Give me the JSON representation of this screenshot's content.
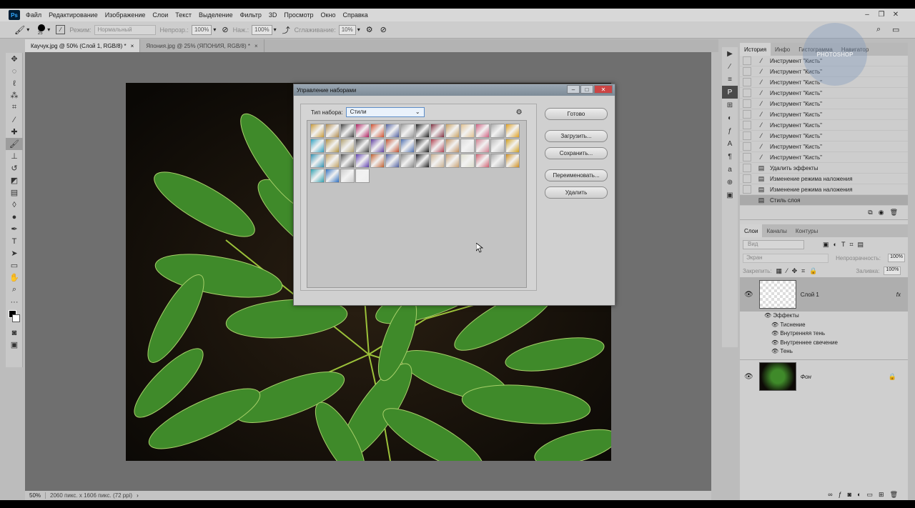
{
  "menu": {
    "logo": "Ps",
    "items": [
      "Файл",
      "Редактирование",
      "Изображение",
      "Слои",
      "Текст",
      "Выделение",
      "Фильтр",
      "3D",
      "Просмотр",
      "Окно",
      "Справка"
    ]
  },
  "options": {
    "brush_size": "25",
    "mode_label": "Режим:",
    "mode_value": "Нормальный",
    "opacity_label": "Непрозр.:",
    "opacity_value": "100%",
    "flow_label": "Наж.:",
    "flow_value": "100%",
    "smooth_label": "Сглаживание:",
    "smooth_value": "10%"
  },
  "tabs": [
    {
      "label": "Каучук.jpg @ 50% (Слой 1, RGB/8) *",
      "close": "×"
    },
    {
      "label": "Япония.jpg @ 25% (ЯПОНИЯ, RGB/8) *",
      "close": "×"
    }
  ],
  "status": {
    "zoom": "50%",
    "info": "2060 пикс. х 1606 пикс. (72 ppi)"
  },
  "dialog": {
    "title": "Управление наборами",
    "type_label": "Тип набора:",
    "type_value": "Стили",
    "buttons": [
      "Готово",
      "Загрузить...",
      "Сохранить...",
      "Переименовать...",
      "Удалить"
    ],
    "swatch_colors": [
      "#c89a3a",
      "#b08a4a",
      "#444",
      "#b02060",
      "#d05030",
      "#5060a0",
      "#999",
      "#222",
      "#803040",
      "#c8a060",
      "#e0c090",
      "#d06080",
      "#aaa",
      "#e0a020",
      "#30a0c0",
      "#b09040",
      "#b0a070",
      "#444",
      "#6040a0",
      "#c05030",
      "#5070b0",
      "#222",
      "#b04050",
      "#c09060",
      "#ddd",
      "#d08090",
      "#bbb",
      "#d0a020",
      "#3090b0",
      "#c0a060",
      "#555",
      "#6040b0",
      "#c06030",
      "#5060a0",
      "#888",
      "#222",
      "#c9b090",
      "#c8a070",
      "#ddc",
      "#d06070",
      "#aaa",
      "#d09020",
      "#30a0b0",
      "#3070c0",
      "#ccc",
      "#eee"
    ]
  },
  "history": {
    "tabs": [
      "История",
      "Инфо",
      "Гистограмма",
      "Навигатор"
    ],
    "items": [
      "Инструмент \"Кисть\"",
      "Инструмент \"Кисть\"",
      "Инструмент \"Кисть\"",
      "Инструмент \"Кисть\"",
      "Инструмент \"Кисть\"",
      "Инструмент \"Кисть\"",
      "Инструмент \"Кисть\"",
      "Инструмент \"Кисть\"",
      "Инструмент \"Кисть\"",
      "Инструмент \"Кисть\"",
      "Удалить эффекты",
      "Изменение режима наложения",
      "Изменение режима наложения",
      "Стиль слоя"
    ]
  },
  "layers": {
    "tabs": [
      "Слои",
      "Каналы",
      "Контуры"
    ],
    "filter_placeholder": "Вид",
    "blend_mode": "Экран",
    "opacity_label": "Непрозрачность:",
    "opacity_value": "100%",
    "lock_label": "Закрепить:",
    "fill_label": "Заливка:",
    "fill_value": "100%",
    "layer1": {
      "name": "Слой 1",
      "fx": "fx"
    },
    "effects_label": "Эффекты",
    "effects": [
      "Тиснение",
      "Внутренняя тень",
      "Внутреннее свечение",
      "Тень"
    ],
    "background": {
      "name": "Фон"
    }
  },
  "watermark": {
    "text": "PHOTOSHOP"
  }
}
